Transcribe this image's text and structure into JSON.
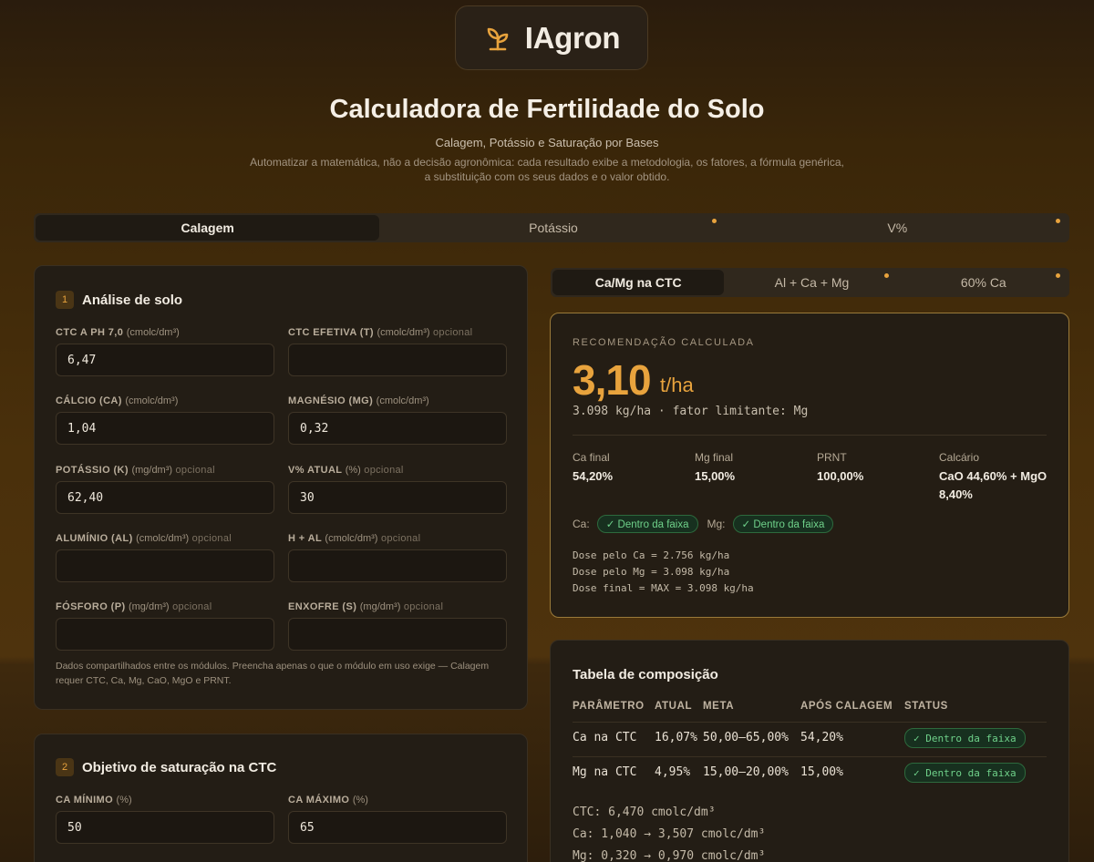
{
  "brand": {
    "name": "IAgron"
  },
  "header": {
    "title": "Calculadora de Fertilidade do Solo",
    "subtitle": "Calagem, Potássio e Saturação por Bases",
    "description": "Automatizar a matemática, não a decisão agronômica: cada resultado exibe a metodologia, os fatores, a fórmula genérica, a substituição com os seus dados e o valor obtido."
  },
  "main_tabs": [
    {
      "label": "Calagem",
      "active": true
    },
    {
      "label": "Potássio",
      "active": false
    },
    {
      "label": "V%",
      "active": false
    }
  ],
  "soil": {
    "num": "1",
    "title": "Análise de solo",
    "fields": {
      "ctc": {
        "label": "CTC A PH 7,0",
        "unit": "(cmolc/dm³)",
        "optional": "",
        "value": "6,47"
      },
      "ctc_ef": {
        "label": "CTC EFETIVA (T)",
        "unit": "(cmolc/dm³)",
        "optional": "opcional",
        "value": ""
      },
      "ca": {
        "label": "CÁLCIO (CA)",
        "unit": "(cmolc/dm³)",
        "optional": "",
        "value": "1,04"
      },
      "mg": {
        "label": "MAGNÉSIO (MG)",
        "unit": "(cmolc/dm³)",
        "optional": "",
        "value": "0,32"
      },
      "k": {
        "label": "POTÁSSIO (K)",
        "unit": "(mg/dm³)",
        "optional": "opcional",
        "value": "62,40"
      },
      "v": {
        "label": "V% ATUAL",
        "unit": "(%)",
        "optional": "opcional",
        "value": "30"
      },
      "al": {
        "label": "ALUMÍNIO (AL)",
        "unit": "(cmolc/dm³)",
        "optional": "opcional",
        "value": ""
      },
      "hal": {
        "label": "H + AL",
        "unit": "(cmolc/dm³)",
        "optional": "opcional",
        "value": ""
      },
      "p": {
        "label": "FÓSFORO (P)",
        "unit": "(mg/dm³)",
        "optional": "opcional",
        "value": ""
      },
      "s": {
        "label": "ENXOFRE (S)",
        "unit": "(mg/dm³)",
        "optional": "opcional",
        "value": ""
      }
    },
    "note": "Dados compartilhados entre os módulos. Preencha apenas o que o módulo em uso exige — Calagem requer CTC, Ca, Mg, CaO, MgO e PRNT."
  },
  "objective": {
    "num": "2",
    "title": "Objetivo de saturação na CTC",
    "fields": {
      "ca_min": {
        "label": "CA MÍNIMO",
        "unit": "(%)",
        "value": "50"
      },
      "ca_max": {
        "label": "CA MÁXIMO",
        "unit": "(%)",
        "value": "65"
      }
    }
  },
  "sub_tabs": [
    {
      "label": "Ca/Mg na CTC",
      "active": true
    },
    {
      "label": "Al + Ca + Mg",
      "active": false
    },
    {
      "label": "60% Ca",
      "active": false
    }
  ],
  "result": {
    "kicker": "RECOMENDAÇÃO CALCULADA",
    "value": "3,10",
    "unit": "t/ha",
    "detail": "3.098 kg/ha · fator limitante: Mg",
    "stats": [
      {
        "label": "Ca final",
        "value": "54,20%"
      },
      {
        "label": "Mg final",
        "value": "15,00%"
      },
      {
        "label": "PRNT",
        "value": "100,00%"
      },
      {
        "label": "Calcário",
        "value": "CaO 44,60% + MgO 8,40%"
      }
    ],
    "ca_label": "Ca:",
    "mg_label": "Mg:",
    "ca_badge": "✓ Dentro da faixa",
    "mg_badge": "✓ Dentro da faixa",
    "dose_lines": [
      "Dose pelo Ca = 2.756 kg/ha",
      "Dose pelo Mg = 3.098 kg/ha",
      "Dose final = MAX = 3.098 kg/ha"
    ]
  },
  "composition": {
    "title": "Tabela de composição",
    "headers": [
      "PARÂMETRO",
      "ATUAL",
      "META",
      "APÓS CALAGEM",
      "STATUS"
    ],
    "rows": [
      {
        "param": "Ca na CTC",
        "atual": "16,07%",
        "meta": "50,00–65,00%",
        "apos": "54,20%",
        "status": "✓ Dentro da faixa"
      },
      {
        "param": "Mg na CTC",
        "atual": "4,95%",
        "meta": "15,00–20,00%",
        "apos": "15,00%",
        "status": "✓ Dentro da faixa"
      }
    ],
    "calc_lines": [
      "CTC: 6,470 cmolc/dm³",
      "Ca: 1,040 → 3,507 cmolc/dm³",
      "Mg: 0,320 → 0,970 cmolc/dm³"
    ]
  },
  "colors": {
    "accent": "#e8a33d",
    "ok": "#6fd18a",
    "ok_bg": "#17301f"
  }
}
